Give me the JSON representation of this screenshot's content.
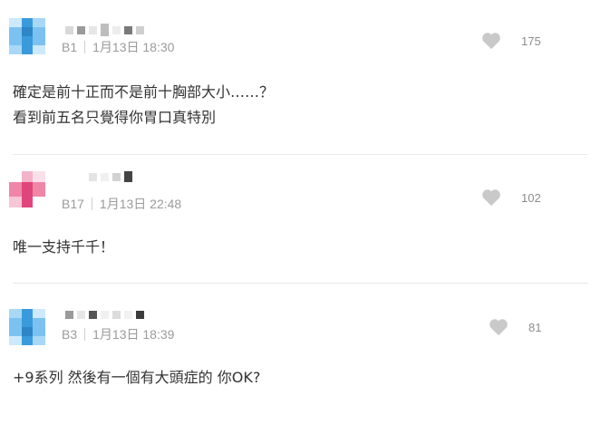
{
  "comments": [
    {
      "floor": "B1",
      "date": "1月13日 18:30",
      "likes": "175",
      "avatar_color": "#3a9bdc",
      "lines": [
        "確定是前十正而不是前十胸部大小……？",
        "看到前五名只覺得你胃口真特別"
      ]
    },
    {
      "floor": "B17",
      "date": "1月13日 22:48",
      "likes": "102",
      "avatar_color": "#e0457b",
      "lines": [
        "唯一支持千千！"
      ]
    },
    {
      "floor": "B3",
      "date": "1月13日 18:39",
      "likes": "81",
      "avatar_color": "#3a9bdc",
      "lines": [
        "+9系列 然後有一個有大頭症的 你OK?"
      ]
    }
  ],
  "icons": {
    "avatar": "pixel-avatar-icon",
    "like": "heart-icon"
  }
}
